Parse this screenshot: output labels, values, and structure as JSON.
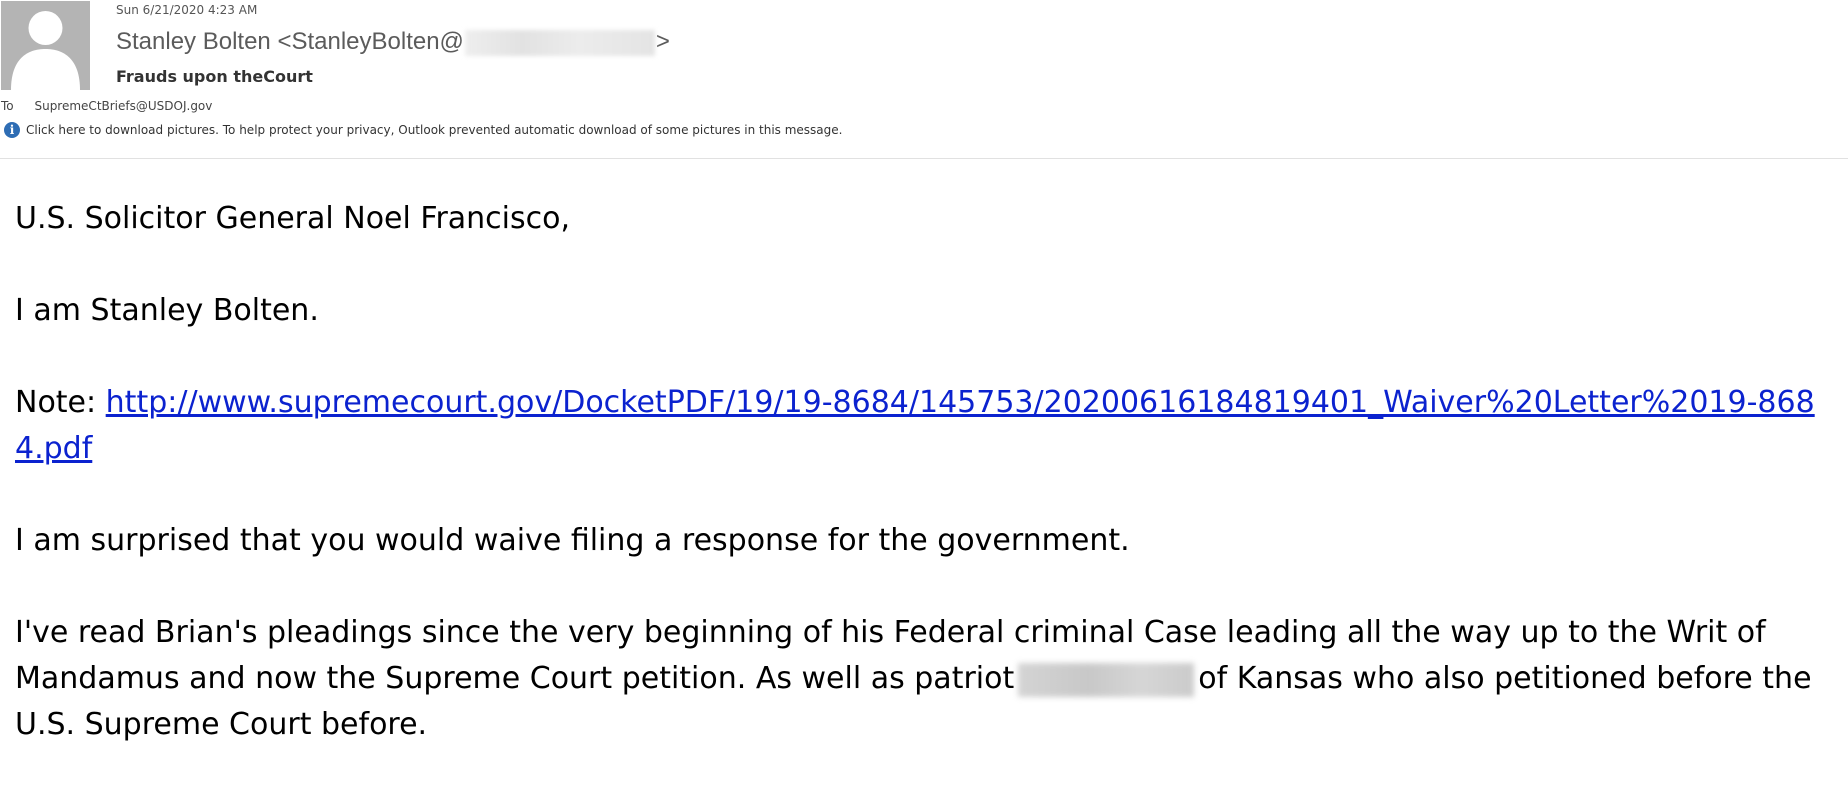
{
  "header": {
    "date": "Sun 6/21/2020 4:23 AM",
    "sender_prefix": "Stanley Bolten <StanleyBolten@",
    "sender_suffix": ">",
    "subject": "Frauds upon theCourt",
    "to_label": "To",
    "to_address": "SupremeCtBriefs@USDOJ.gov",
    "info_text": "Click here to download pictures. To help protect your privacy, Outlook prevented automatic download of some pictures in this message."
  },
  "body": {
    "greeting": "U.S. Solicitor General Noel Francisco,",
    "intro": "I am Stanley Bolten.",
    "note_label": "Note: ",
    "note_link": "http://www.supremecourt.gov/DocketPDF/19/19-8684/145753/20200616184819401_Waiver%20Letter%2019-8684.pdf",
    "surprised": "I am surprised that you would waive filing a response for the government.",
    "paragraph_part1": "I've read Brian's pleadings since the very beginning of his Federal criminal Case leading all the way up to the Writ of Mandamus and now the Supreme Court petition. As well as patriot",
    "paragraph_part2": "of Kansas who also petitioned before the U.S. Supreme Court before."
  },
  "colors": {
    "link": "#0b22cf",
    "info_icon": "#2e6db4",
    "avatar_bg": "#b4b4b4"
  },
  "icons": {
    "avatar": "person-silhouette",
    "info": "info-icon"
  }
}
